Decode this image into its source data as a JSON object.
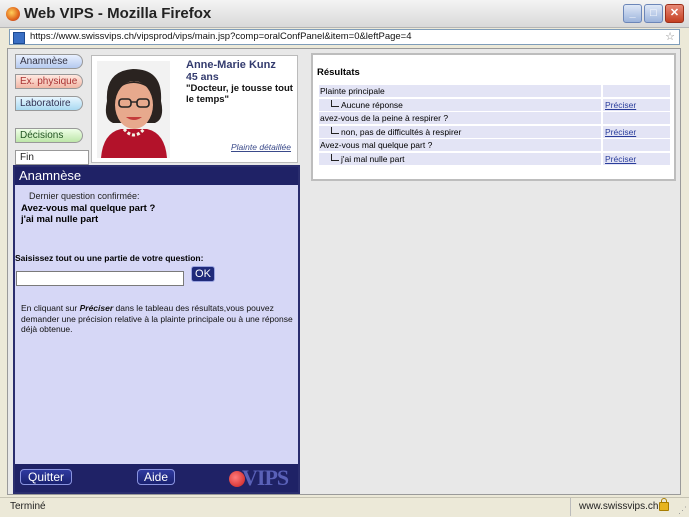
{
  "window": {
    "title": "Web VIPS - Mozilla Firefox",
    "url": "https://www.swissvips.ch/vipsprod/vips/main.jsp?comp=oralConfPanel&item=0&leftPage=4"
  },
  "tabs": [
    {
      "label": "Anamnèse"
    },
    {
      "label": "Ex. physique"
    },
    {
      "label": "Laboratoire"
    },
    {
      "label": "Décisions"
    },
    {
      "label": "Fin consultation"
    }
  ],
  "patient": {
    "name": "Anne-Marie Kunz",
    "age": "45 ans",
    "quote": "\"Docteur, je tousse tout le temps\"",
    "details_link": "Plainte détaillée"
  },
  "anamnese": {
    "header": "Anamnèse",
    "confirmed_label": "Dernier question confirmée:",
    "confirmed_question": "Avez-vous mal quelque part ?",
    "confirmed_answer": "j'ai mal nulle part",
    "ask_label": "Saisissez tout ou une partie de votre question:",
    "input_value": "",
    "ok_label": "OK",
    "help_prefix": "En cliquant sur ",
    "help_keyword": "Préciser",
    "help_suffix": " dans le tableau des résultats,vous pouvez demander une précision relative à la  plainte principale ou à une réponse déjà obtenue.",
    "quit_label": "Quitter",
    "help_button": "Aide",
    "logo_text": "VIPS"
  },
  "results": {
    "title": "Résultats",
    "rows": [
      {
        "text": "Plainte principale",
        "action": ""
      },
      {
        "text": "Aucune réponse",
        "action": "Préciser"
      },
      {
        "text": "avez-vous de la peine à respirer ?",
        "action": ""
      },
      {
        "text": "non, pas de difficultés à respirer",
        "action": "Préciser"
      },
      {
        "text": "Avez-vous mal quelque part ?",
        "action": ""
      },
      {
        "text": "j'ai mal nulle part",
        "action": "Préciser"
      }
    ]
  },
  "status": {
    "left": "Terminé",
    "domain": "www.swissvips.ch"
  },
  "colors": {
    "panel_dark": "#1f2266",
    "panel_light": "#d6d7f6",
    "link": "#2a3d9b"
  }
}
